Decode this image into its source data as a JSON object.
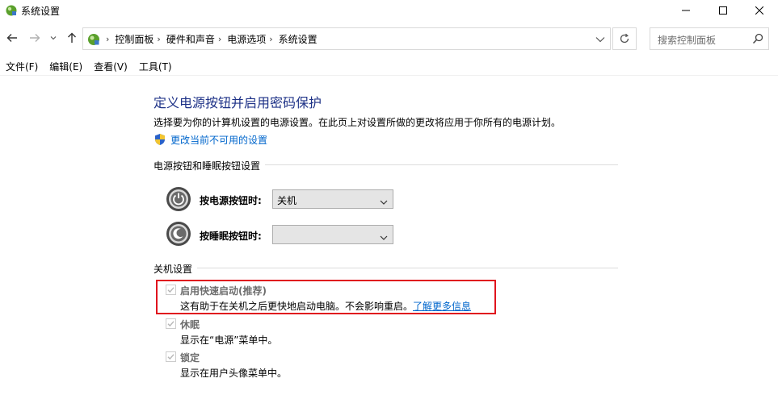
{
  "window": {
    "title": "系统设置"
  },
  "nav": {
    "breadcrumbs": [
      "控制面板",
      "硬件和声音",
      "电源选项",
      "系统设置"
    ],
    "search_placeholder": "搜索控制面板"
  },
  "menu": {
    "items": [
      "文件(F)",
      "编辑(E)",
      "查看(V)",
      "工具(T)"
    ]
  },
  "page": {
    "heading": "定义电源按钮并启用密码保护",
    "description": "选择要为你的计算机设置的电源设置。在此页上对设置所做的更改将应用于你所有的电源计划。",
    "change_link": "更改当前不可用的设置"
  },
  "power_section": {
    "title": "电源按钮和睡眠按钮设置",
    "power_button": {
      "label": "按电源按钮时:",
      "value": "关机"
    },
    "sleep_button": {
      "label": "按睡眠按钮时:",
      "value": ""
    }
  },
  "shutdown_section": {
    "title": "关机设置",
    "options": [
      {
        "label": "启用快速启动(推荐)",
        "description": "这有助于在关机之后更快地启动电脑。不会影响重启。",
        "link": "了解更多信息",
        "checked": true
      },
      {
        "label": "休眠",
        "description": "显示在“电源”菜单中。",
        "checked": true
      },
      {
        "label": "锁定",
        "description": "显示在用户头像菜单中。",
        "checked": true
      }
    ]
  },
  "colors": {
    "heading": "#1e3287",
    "link": "#0066cc",
    "highlight": "#e0141e"
  }
}
